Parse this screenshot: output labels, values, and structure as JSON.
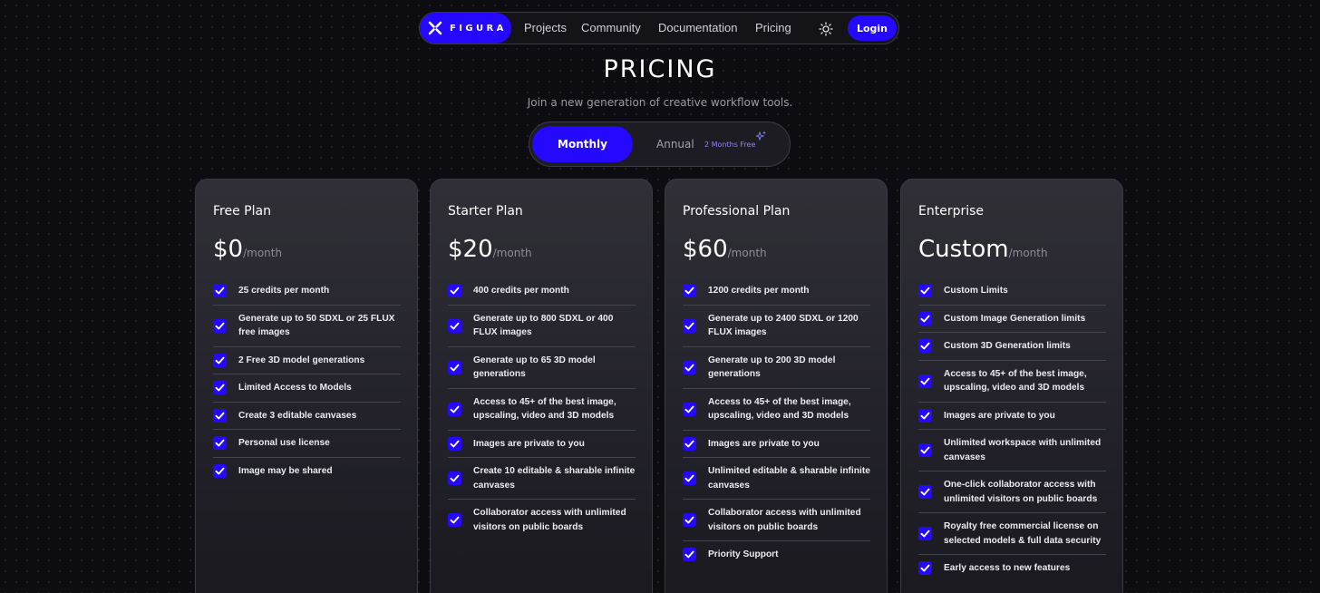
{
  "nav": {
    "logo_text": "FIGURA",
    "links": [
      "Projects",
      "Community",
      "Documentation",
      "Pricing"
    ],
    "theme_icon": "sun-icon",
    "login_label": "Login"
  },
  "header": {
    "title": "PRICING",
    "subtitle": "Join a new generation of creative workflow tools."
  },
  "billing_toggle": {
    "monthly_label": "Monthly",
    "annual_label": "Annual",
    "annual_badge": "2 Months Free",
    "selected": "Monthly",
    "badge_icon": "sparkle-icon"
  },
  "colors": {
    "accent": "#2408ff",
    "background": "#0d0c10",
    "card": "#2a2930"
  },
  "plans": [
    {
      "name": "Free Plan",
      "price": "$0",
      "period": "/month",
      "features": [
        "25 credits per month",
        "Generate up to 50 SDXL or 25 FLUX free images",
        "2 Free 3D model generations",
        "Limited Access to Models",
        "Create 3 editable canvases",
        "Personal use license",
        "Image may be shared"
      ]
    },
    {
      "name": "Starter Plan",
      "price": "$20",
      "period": "/month",
      "features": [
        "400 credits per month",
        "Generate up to 800 SDXL or 400 FLUX images",
        "Generate up to 65 3D model generations",
        "Access to 45+ of the best image, upscaling, video and 3D models",
        "Images are private to you",
        "Create 10 editable & sharable infinite canvases",
        "Collaborator access with unlimited visitors on public boards"
      ]
    },
    {
      "name": "Professional Plan",
      "price": "$60",
      "period": "/month",
      "features": [
        "1200 credits per month",
        "Generate up to 2400 SDXL or 1200 FLUX images",
        "Generate up to 200 3D model generations",
        "Access to 45+ of the best image, upscaling, video and 3D models",
        "Images are private to you",
        "Unlimited editable & sharable infinite canvases",
        "Collaborator access with unlimited visitors on public boards",
        "Priority Support"
      ]
    },
    {
      "name": "Enterprise",
      "price": "Custom",
      "period": "/month",
      "features": [
        "Custom Limits",
        "Custom Image Generation limits",
        "Custom 3D Generation limits",
        "Access to 45+ of the best image, upscaling, video and 3D models",
        "Images are private to you",
        "Unlimited workspace with unlimited canvases",
        "One-click collaborator access with unlimited visitors on public boards",
        "Royalty free commercial license on selected models & full data security",
        "Early access to new features"
      ]
    }
  ]
}
